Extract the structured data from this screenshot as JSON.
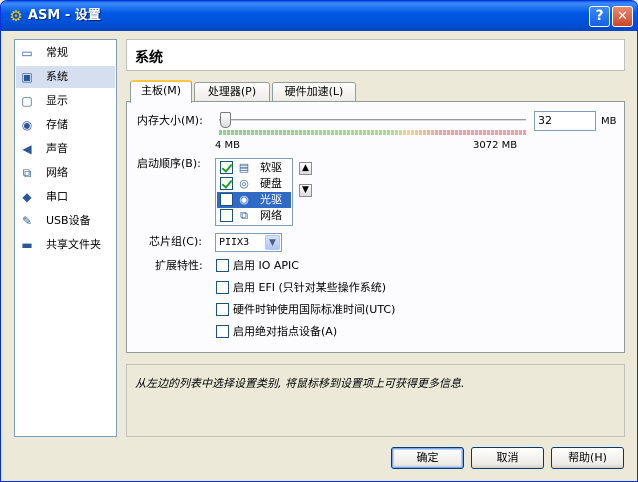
{
  "window": {
    "title": "ASM - 设置",
    "help_button": "?",
    "close_button": "✕"
  },
  "sidebar": {
    "items": [
      {
        "label": "常规",
        "icon": "general-icon"
      },
      {
        "label": "系统",
        "icon": "system-icon",
        "selected": true
      },
      {
        "label": "显示",
        "icon": "display-icon"
      },
      {
        "label": "存储",
        "icon": "storage-icon"
      },
      {
        "label": "声音",
        "icon": "audio-icon"
      },
      {
        "label": "网络",
        "icon": "network-icon"
      },
      {
        "label": "串口",
        "icon": "serial-port-icon"
      },
      {
        "label": "USB设备",
        "icon": "usb-icon"
      },
      {
        "label": "共享文件夹",
        "icon": "shared-folder-icon"
      }
    ]
  },
  "header": {
    "title": "系统"
  },
  "tabs": [
    {
      "label": "主板(M)",
      "active": true
    },
    {
      "label": "处理器(P)",
      "active": false
    },
    {
      "label": "硬件加速(L)",
      "active": false
    }
  ],
  "motherboard": {
    "memory_label": "内存大小(M):",
    "memory_value": "32",
    "memory_unit": "MB",
    "memory_min_label": "4 MB",
    "memory_max_label": "3072 MB",
    "memory_fraction": 0.009,
    "boot_order_label": "启动顺序(B):",
    "boot_items": [
      {
        "label": "软驱",
        "checked": true,
        "icon": "floppy-icon",
        "selected": false
      },
      {
        "label": "硬盘",
        "checked": true,
        "icon": "hard-disk-icon",
        "selected": false
      },
      {
        "label": "光驱",
        "checked": false,
        "icon": "optical-drive-icon",
        "selected": true
      },
      {
        "label": "网络",
        "checked": false,
        "icon": "network-boot-icon",
        "selected": false
      }
    ],
    "chipset_label": "芯片组(C):",
    "chipset_value": "PIIX3",
    "extended_label": "扩展特性:",
    "features": [
      {
        "label": "启用 IO APIC",
        "checked": false
      },
      {
        "label": "启用 EFI (只针对某些操作系统)",
        "checked": false
      },
      {
        "label": "硬件时钟使用国际标准时间(UTC)",
        "checked": false
      },
      {
        "label": "启用绝对指点设备(A)",
        "checked": false
      }
    ]
  },
  "info": {
    "text": "从左边的列表中选择设置类别, 将鼠标移到设置项上可获得更多信息."
  },
  "buttons": {
    "ok": "确定",
    "cancel": "取消",
    "help": "帮助(H)"
  }
}
